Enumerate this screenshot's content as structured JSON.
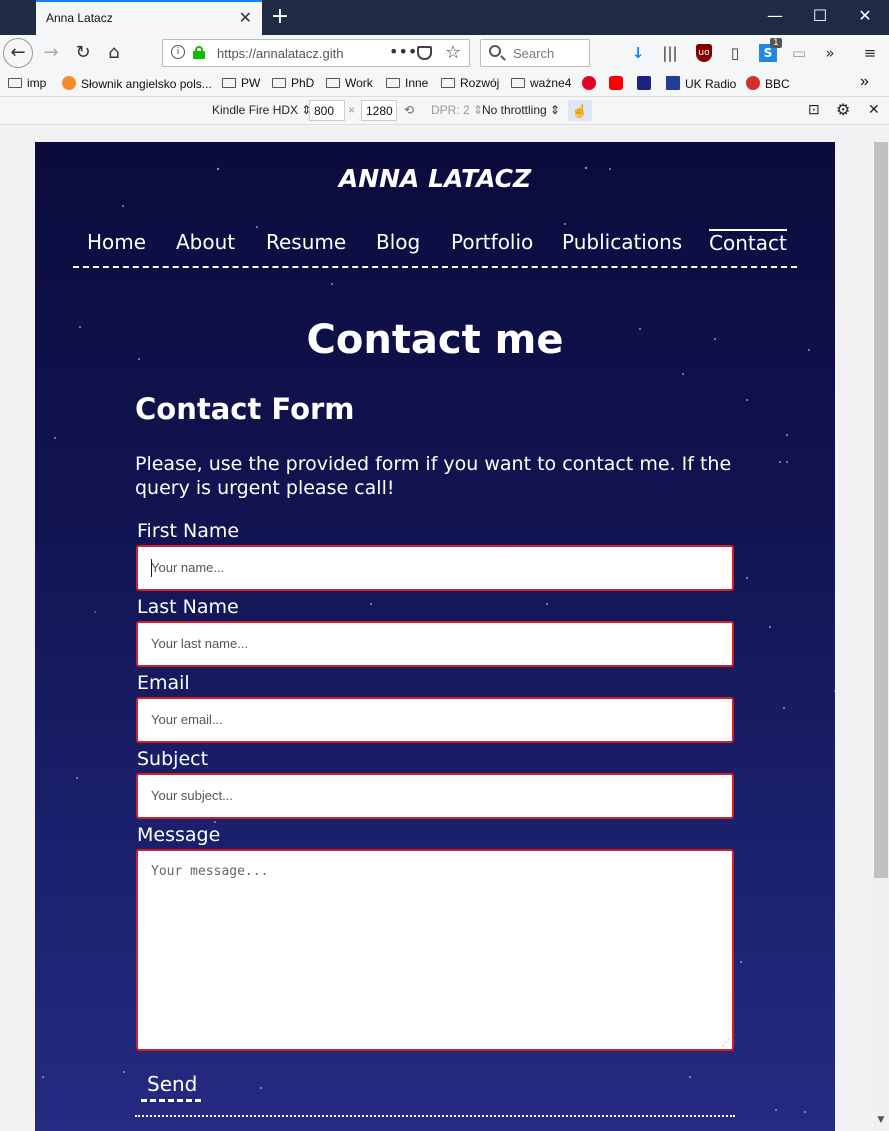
{
  "browser": {
    "tab_title": "Anna Latacz",
    "tab_close": "✕",
    "new_tab": "+",
    "window_controls": {
      "minimize": "—",
      "maximize": "☐",
      "close": "✕"
    },
    "url": "https://annalatacz.gith",
    "url_menu": "•••",
    "search_placeholder": "Search",
    "sync_badge": "1",
    "bookmarks": [
      {
        "label": "imp",
        "icon": "folder-icon"
      },
      {
        "label": "Słownik angielsko pols...",
        "icon": "dictionary-icon"
      },
      {
        "label": "PW",
        "icon": "folder-icon"
      },
      {
        "label": "PhD",
        "icon": "folder-icon"
      },
      {
        "label": "Work",
        "icon": "folder-icon"
      },
      {
        "label": "Inne",
        "icon": "folder-icon"
      },
      {
        "label": "Rozwój",
        "icon": "folder-icon"
      },
      {
        "label": "ważne4",
        "icon": "folder-icon"
      },
      {
        "label": "UK Radio",
        "icon": "uk-flag-icon"
      },
      {
        "label": "BBC",
        "icon": "bbc-icon"
      }
    ],
    "responsive": {
      "device": "Kindle Fire HDX",
      "width": "800",
      "times": "×",
      "height": "1280",
      "dpr": "DPR: 2",
      "throttling": "No throttling"
    }
  },
  "site": {
    "title": "ANNA LATACZ",
    "nav": [
      {
        "label": "Home"
      },
      {
        "label": "About"
      },
      {
        "label": "Resume"
      },
      {
        "label": "Blog"
      },
      {
        "label": "Portfolio"
      },
      {
        "label": "Publications"
      },
      {
        "label": "Contact",
        "active": true
      }
    ],
    "page_title": "Contact me",
    "form_title": "Contact Form",
    "intro": "Please, use the provided form if you want to contact me. If the query is urgent please call!",
    "form": {
      "first_name": {
        "label": "First Name",
        "placeholder": "Your name..."
      },
      "last_name": {
        "label": "Last Name",
        "placeholder": "Your last name..."
      },
      "email": {
        "label": "Email",
        "placeholder": "Your email..."
      },
      "subject": {
        "label": "Subject",
        "placeholder": "Your subject..."
      },
      "message": {
        "label": "Message",
        "placeholder": "Your message..."
      },
      "send": "Send"
    }
  },
  "colors": {
    "background_top": "#0b0b3d",
    "background_bottom": "#262b82",
    "input_border": "#d0202a",
    "accent": "#0a84ff"
  }
}
